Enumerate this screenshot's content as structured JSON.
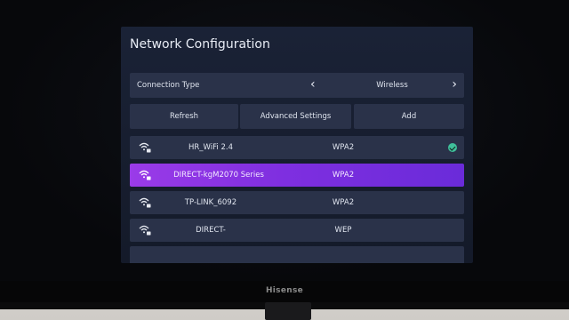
{
  "page": {
    "title": "Network Configuration",
    "brand": "Hisense"
  },
  "connection": {
    "label": "Connection Type",
    "value": "Wireless",
    "prev_icon": "chevron-left-icon",
    "next_icon": "chevron-right-icon"
  },
  "actions": {
    "refresh": "Refresh",
    "advanced": "Advanced Settings",
    "add": "Add"
  },
  "networks": [
    {
      "ssid": "HR_WiFi 2.4",
      "security": "WPA2",
      "connected": true,
      "selected": false
    },
    {
      "ssid": "DIRECT-kgM2070 Series",
      "security": "WPA2",
      "connected": false,
      "selected": true
    },
    {
      "ssid": "TP-LINK_6092",
      "security": "WPA2",
      "connected": false,
      "selected": false
    },
    {
      "ssid": "DIRECT-",
      "security": "WEP",
      "connected": false,
      "selected": false
    }
  ],
  "colors": {
    "panel_bg": "#161d2e",
    "row_bg": "#2a3249",
    "selected_gradient_start": "#9a3be8",
    "selected_gradient_end": "#6a2bd9",
    "connected_check": "#3fbf9a"
  }
}
